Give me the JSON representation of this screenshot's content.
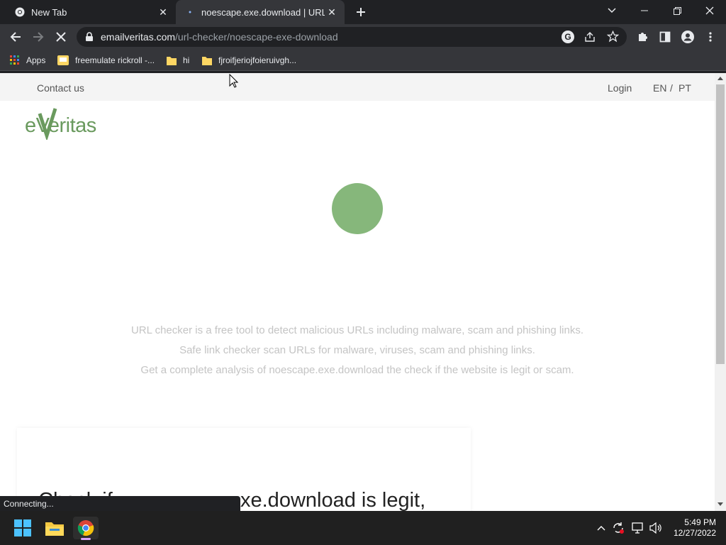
{
  "tabs": [
    {
      "title": "New Tab",
      "icon": "chrome-icon"
    },
    {
      "title": "noescape.exe.download | URL Ch",
      "icon": "loading-icon"
    }
  ],
  "address": {
    "domain": "emailveritas.com",
    "path": "/url-checker/noescape-exe-download"
  },
  "bookmarks": [
    {
      "label": "Apps",
      "icon": "apps-grid-icon"
    },
    {
      "label": "freemulate rickroll -...",
      "icon": "bookmark-page-icon"
    },
    {
      "label": "hi",
      "icon": "folder-icon"
    },
    {
      "label": "fjroifjeriojfoieruivgh...",
      "icon": "folder-icon"
    }
  ],
  "site": {
    "nav": {
      "contact": "Contact us",
      "login": "Login",
      "lang_en": "EN",
      "lang_sep": "/",
      "lang_pt": "PT"
    },
    "logo": {
      "text": "eVeritas",
      "color": "#6a9a5e"
    },
    "spinner_color": "#86b77b",
    "description": [
      "URL checker is a free tool to detect malicious URLs including malware, scam and phishing links.",
      "Safe link checker scan URLs for malware, viruses, scam and phishing links.",
      "Get a complete analysis of noescape.exe.download the check if the website is legit or scam."
    ],
    "card_heading_left": "Check if",
    "card_heading_right": "xe.download is legit,"
  },
  "status_text": "Connecting...",
  "clock": {
    "time": "5:49 PM",
    "date": "12/27/2022"
  }
}
